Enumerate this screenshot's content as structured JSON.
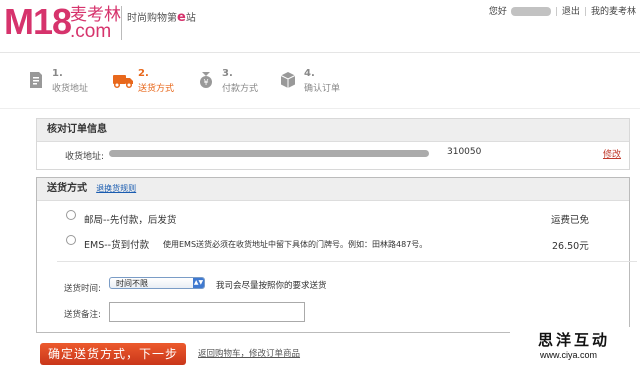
{
  "header": {
    "logo_main": "M18",
    "logo_sub": "麦考林",
    "logo_domain": ".com",
    "slogan_prefix": "时尚购物第",
    "slogan_e": "e",
    "slogan_suffix": "站",
    "greeting": "您好",
    "logout": "退出",
    "my_account": "我的麦考林"
  },
  "steps": [
    {
      "num": "1.",
      "label": "收货地址",
      "icon": "address-icon"
    },
    {
      "num": "2.",
      "label": "送货方式",
      "icon": "truck-icon",
      "active": true
    },
    {
      "num": "3.",
      "label": "付款方式",
      "icon": "payment-icon"
    },
    {
      "num": "4.",
      "label": "确认订单",
      "icon": "box-icon"
    }
  ],
  "order_info": {
    "title": "核对订单信息",
    "address_label": "收货地址:",
    "zip": "310050",
    "edit": "修改"
  },
  "shipping": {
    "title": "送货方式",
    "rules_link": "退换货规则",
    "options": [
      {
        "name": "邮局--先付款，后发货",
        "note": "",
        "fee": "运费已免"
      },
      {
        "name": "EMS--货到付款",
        "note": "使用EMS送货必须在收货地址中留下具体的门牌号。例如：田林路487号。",
        "fee": "26.50元"
      }
    ],
    "time_label": "送货时间:",
    "time_value": "时间不限",
    "time_hint": "我司会尽量按照你的要求送货",
    "remark_label": "送货备注:",
    "remark_value": ""
  },
  "actions": {
    "submit": "确定送货方式，下一步",
    "back": "返回购物车，修改订单商品"
  },
  "watermark": {
    "main": "思洋互动",
    "url": "www.ciya.com"
  },
  "colors": {
    "brand": "#d6336c",
    "active_step": "#e8681c",
    "submit": "#d9431f"
  }
}
